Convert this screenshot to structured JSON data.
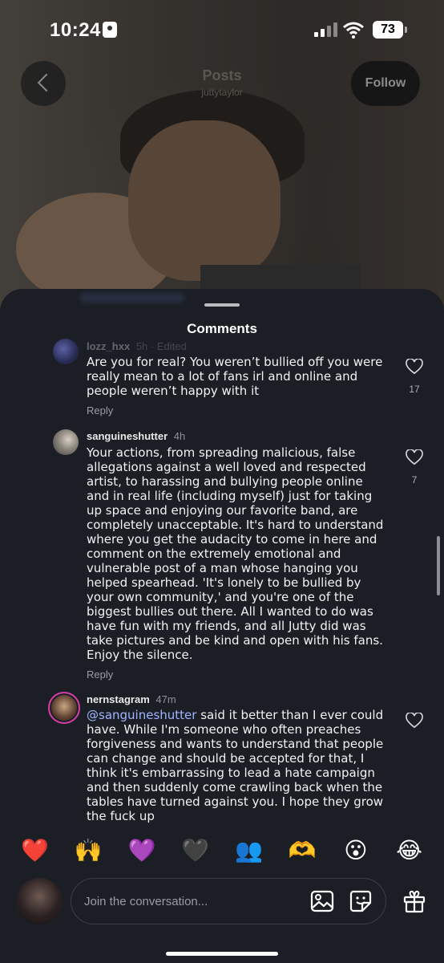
{
  "status_bar": {
    "time": "10:24",
    "battery": "73"
  },
  "nav": {
    "title": "Posts",
    "subtitle": "juttytaylor",
    "follow_label": "Follow"
  },
  "sheet": {
    "title": "Comments"
  },
  "comments": [
    {
      "username": "lozz_hxx",
      "time": "5h · Edited",
      "text": "Are you for real? You weren’t bullied off you were really mean to a lot of fans irl and online and people weren’t happy with it",
      "reply_label": "Reply",
      "likes": "17"
    },
    {
      "username": "sanguineshutter",
      "time": "4h",
      "text": "Your actions, from spreading malicious, false allegations against a well loved and respected artist, to harassing and bullying people online and in real life (including myself) just for taking up space and enjoying our favorite band, are completely unacceptable. It's hard to understand where you get the audacity to come in here and comment on the extremely emotional and vulnerable post of a man whose hanging you helped spearhead. 'It's lonely to be bullied by your own community,' and you're one of the biggest bullies out there. All I wanted to do was have fun with my friends, and all Jutty did was take pictures and be kind and open with his fans. Enjoy the silence.",
      "reply_label": "Reply",
      "likes": "7"
    },
    {
      "username": "nernstagram",
      "time": "47m",
      "mention": "@sanguineshutter",
      "text": " said it better than I ever could have. While I'm someone who often preaches forgiveness and wants to understand that people can change and should be accepted for that, I think it's embarrassing to lead a hate campaign and then suddenly come crawling back when the tables have turned against you. I hope they grow the fuck up"
    }
  ],
  "emoji_bar": [
    "❤️",
    "🙌",
    "💜",
    "🖤",
    "👥",
    "🫶",
    "😮",
    "😂"
  ],
  "composer": {
    "placeholder": "Join the conversation..."
  },
  "icons": {
    "back": "chevron-left-icon",
    "heart": "heart-outline-icon",
    "image": "image-icon",
    "sticker": "sticker-icon",
    "gift": "gift-icon"
  }
}
